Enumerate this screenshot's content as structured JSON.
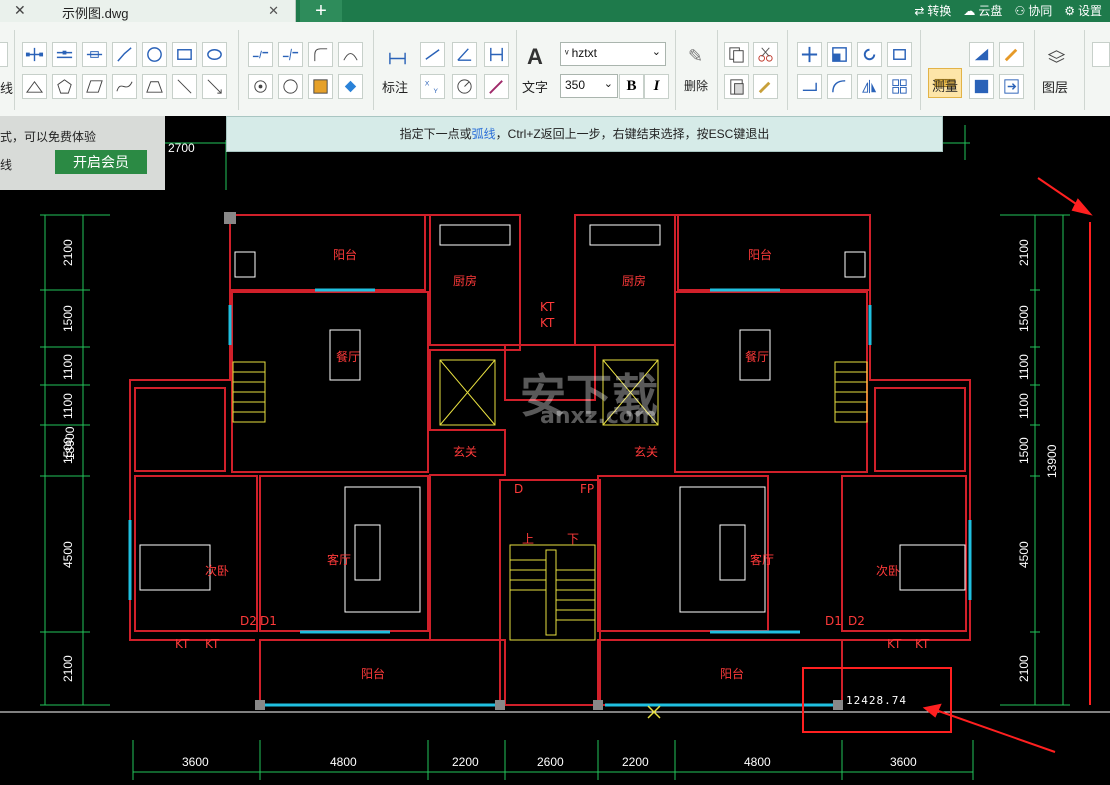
{
  "tab": {
    "title": "示例图.dwg",
    "close_glyph": "✕",
    "x_glyph": "✕",
    "new_tab": "+"
  },
  "topbar": {
    "convert": "转换",
    "cloud": "云盘",
    "collab": "协同",
    "settings": "设置"
  },
  "ribbon": {
    "line_label": "线",
    "annotate_label": "标注",
    "text_label": "文字",
    "font_name": "hztxt",
    "font_size": "350",
    "bold": "B",
    "italic": "I",
    "delete_label": "删除",
    "measure_label": "测量",
    "layer_label": "图层"
  },
  "member": {
    "line1": "式，可以免费体验",
    "line2": "线",
    "button": "开启会员"
  },
  "hint": {
    "before": "指定下一点或",
    "link": "弧线",
    "after": "，Ctrl+Z返回上一步，右键结束选择，按ESC键退出"
  },
  "drawing": {
    "rooms": {
      "balcony_top": "阳台",
      "kitchen": "厨房",
      "dining": "餐厅",
      "foyer": "玄关",
      "living": "客厅",
      "bedroom2": "次卧",
      "balcony_bottom": "阳台",
      "up": "上",
      "down": "下",
      "d1": "D1",
      "d2": "D2",
      "d": "D",
      "fp": "FP",
      "kt": "KT"
    },
    "dims_bottom": [
      "3600",
      "4800",
      "2200",
      "2600",
      "2200",
      "4800",
      "3600"
    ],
    "dims_top": "2700",
    "dims_left": [
      "2100",
      "1500",
      "1100",
      "1100",
      "1500",
      "4500",
      "2100"
    ],
    "total_height": "13900",
    "measure_readout": "12428.74"
  },
  "watermark": {
    "main": "安下载",
    "sub": "anxz.com"
  },
  "colors": {
    "accent": "#1e7a4b",
    "annotation_red": "#ff2020",
    "wall": "#d0202a",
    "window": "#20c0e0",
    "stairs": "#e8e040"
  }
}
